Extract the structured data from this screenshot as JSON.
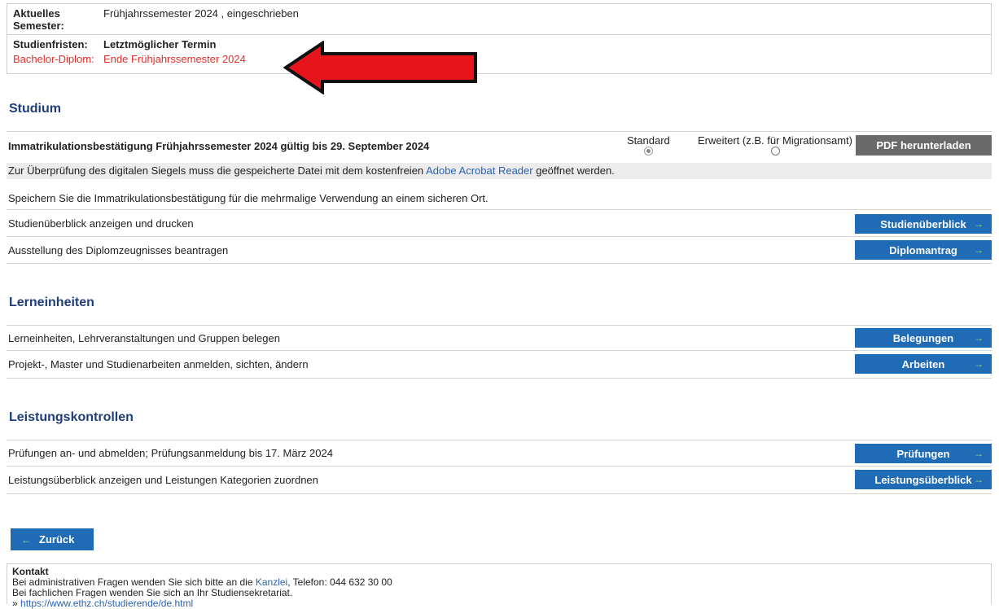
{
  "info": {
    "semester_label": "Aktuelles Semester:",
    "semester_value": "Frühjahrssemester 2024 , eingeschrieben",
    "fristen_label": "Studienfristen:",
    "fristen_value": "Letztmöglicher Termin",
    "diplom_label": "Bachelor-Diplom:",
    "diplom_value": "Ende Frühjahrssemester 2024"
  },
  "studium": {
    "title": "Studium",
    "immatrikulation_text": "Immatrikulationsbestätigung Frühjahrssemester 2024 gültig bis 29. September 2024",
    "option_standard": "Standard",
    "option_extended": "Erweitert (z.B. für Migrationsamt)",
    "pdf_button": "PDF herunterladen",
    "note_prefix": "Zur Überprüfung des digitalen Siegels muss die gespeicherte Datei mit dem kostenfreien ",
    "note_link": "Adobe Acrobat Reader",
    "note_suffix": " geöffnet werden.",
    "save_note": "Speichern Sie die Immatrikulationsbestätigung für die mehrmalige Verwendung an einem sicheren Ort.",
    "rows": [
      {
        "text": "Studienüberblick anzeigen und drucken",
        "button": "Studienüberblick"
      },
      {
        "text": "Ausstellung des Diplomzeugnisses beantragen",
        "button": "Diplomantrag"
      }
    ]
  },
  "lerneinheiten": {
    "title": "Lerneinheiten",
    "rows": [
      {
        "text": "Lerneinheiten, Lehrveranstaltungen und Gruppen belegen",
        "button": "Belegungen"
      },
      {
        "text": "Projekt-, Master und Studienarbeiten anmelden, sichten, ändern",
        "button": "Arbeiten"
      }
    ]
  },
  "leistungskontrollen": {
    "title": "Leistungskontrollen",
    "rows": [
      {
        "text": "Prüfungen an- und abmelden; Prüfungsanmeldung bis 17. März 2024",
        "button": "Prüfungen"
      },
      {
        "text": "Leistungsüberblick anzeigen und Leistungen Kategorien zuordnen",
        "button": "Leistungsüberblick"
      }
    ]
  },
  "back_button": "Zurück",
  "contact": {
    "title": "Kontakt",
    "line1_prefix": "Bei administrativen Fragen wenden Sie sich bitte an die ",
    "line1_link": "Kanzlei",
    "line1_suffix": ", Telefon: 044 632 30 00",
    "line2": "Bei fachlichen Fragen wenden Sie sich an Ihr Studiensekretariat.",
    "url_prefix": "» ",
    "url": "https://www.ethz.ch/studierende/de.html"
  },
  "icons": {
    "right_arrow": "→",
    "left_arrow": "←"
  },
  "colors": {
    "button_blue": "#1f6bb5",
    "heading_blue": "#1f3e78",
    "deadline_red": "#e0302c",
    "arrow_red": "#e8141b"
  }
}
